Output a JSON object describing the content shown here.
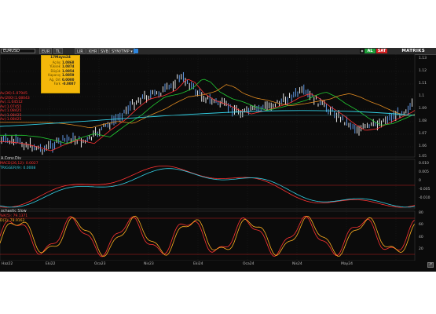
{
  "toolbar": {
    "symbol": "EURUSD",
    "buttons": [
      "EUR",
      "TL",
      "LIR",
      "KHR",
      "SVB",
      "SYM/TMP ▾"
    ],
    "al_label": "AL",
    "sat_label": "SAT",
    "brand": "MATRIKS"
  },
  "tooltip": {
    "title": "17Mayıs24",
    "rows": [
      {
        "label": "Açılış",
        "value": "1.0868"
      },
      {
        "label": "Yüksek",
        "value": "1.0874"
      },
      {
        "label": "Düşük",
        "value": "1.0854"
      },
      {
        "label": "Kapanış",
        "value": "1.0859"
      },
      {
        "label": "Ağ. Ort",
        "value": "0.0000"
      },
      {
        "label": "Fark",
        "value": "-0.0007"
      }
    ]
  },
  "price_legend": [
    {
      "label": "Av(36)",
      "value": ":1.07945",
      "color": "#ff3333"
    },
    {
      "label": "Av(200)",
      "value": ":1.08043",
      "color": "#ff3333"
    },
    {
      "label": "Av(.",
      "value": ":1.04512",
      "color": "#ff3333"
    },
    {
      "label": "Av(",
      "value": ":1.07455",
      "color": "#ff3333"
    },
    {
      "label": "Av(",
      "value": ":1.08425",
      "color": "#ff3333"
    },
    {
      "label": "Av(",
      "value": ":1.08425",
      "color": "#ff3333"
    },
    {
      "label": "Av(",
      "value": ":1.08425",
      "color": "#ff3333"
    }
  ],
  "macd_panel": {
    "title": "A.Conv.Div",
    "lines": [
      {
        "label": "MACD(26,12)",
        "value": ": 0.0027",
        "color": "#ff3333"
      },
      {
        "label": "TRIGGER(9)",
        "value": ": 0.0008",
        "color": "#33d1e6"
      }
    ]
  },
  "stoch_panel": {
    "title": "ochastic Slow",
    "lines": [
      {
        "label": "%K(5)",
        "value": ": 79.1371",
        "color": "#ff3333"
      },
      {
        "label": "D(3)",
        "value": ": 78.9162",
        "color": "#ffb020"
      }
    ]
  },
  "price_axis": [
    "1.13",
    "1.12",
    "1.11",
    "1.1",
    "1.09",
    "1.08",
    "1.07",
    "1.06",
    "1.05"
  ],
  "macd_axis": [
    "0.010",
    "0.005",
    "0",
    "-0.005",
    "-0.010"
  ],
  "stoch_axis": [
    "80",
    "60",
    "40",
    "20"
  ],
  "x_axis": [
    "Haz22",
    "Eki22",
    "Oca23",
    "Nis23",
    "Eki24",
    "Oca24",
    "Nis24",
    "May24"
  ],
  "corner_icon": "↗",
  "colors": {
    "up": "#6aa9ff",
    "down": "#ffffff",
    "ma_short": "#ff3333",
    "ma_mid": "#22cc33",
    "ma_long": "#e08a20",
    "ma_trend": "#33d1e6",
    "zero_line": "#c02020",
    "grid": "#2a2a2a",
    "tooltip_bg": "#f5b80a"
  }
}
